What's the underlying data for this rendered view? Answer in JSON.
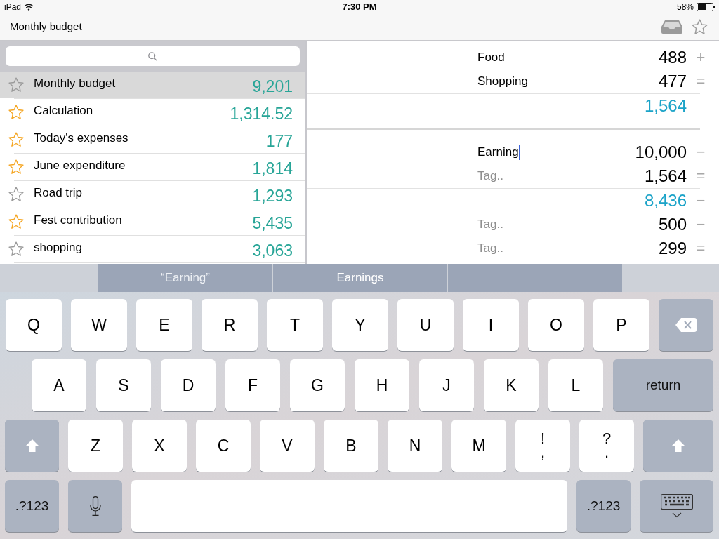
{
  "status_bar": {
    "device": "iPad",
    "time": "7:30 PM",
    "battery": "58%"
  },
  "nav_bar": {
    "title": "Monthly budget"
  },
  "sidebar": {
    "items": [
      {
        "title": "Monthly budget",
        "total": "9,201",
        "starred": false,
        "selected": true
      },
      {
        "title": "Calculation",
        "total": "1,314.52",
        "starred": true,
        "selected": false
      },
      {
        "title": "Today's expenses",
        "total": "177",
        "starred": true,
        "selected": false
      },
      {
        "title": "June expenditure",
        "total": "1,814",
        "starred": true,
        "selected": false
      },
      {
        "title": "Road trip",
        "total": "1,293",
        "starred": false,
        "selected": false
      },
      {
        "title": "Fest contribution",
        "total": "5,435",
        "starred": true,
        "selected": false
      },
      {
        "title": "shopping",
        "total": "3,063",
        "starred": false,
        "selected": false
      }
    ]
  },
  "sheet": {
    "sections": [
      {
        "rows": [
          {
            "kind": "entry",
            "tag": "Food",
            "amount": "488",
            "operator": "+",
            "focused": false
          },
          {
            "kind": "entry",
            "tag": "Shopping",
            "amount": "477",
            "operator": "=",
            "focused": false
          },
          {
            "kind": "total",
            "amount": "1,564"
          }
        ]
      },
      {
        "rows": [
          {
            "kind": "entry",
            "tag": "Earning",
            "amount": "10,000",
            "operator": "−",
            "focused": true
          },
          {
            "kind": "entry",
            "placeholder": "Tag..",
            "amount": "1,564",
            "operator": "=",
            "focused": false
          },
          {
            "kind": "total",
            "amount": "8,436",
            "operator": "−"
          },
          {
            "kind": "entry",
            "placeholder": "Tag..",
            "amount": "500",
            "operator": "−",
            "focused": false
          },
          {
            "kind": "entry",
            "placeholder": "Tag..",
            "amount": "299",
            "operator": "=",
            "focused": false
          }
        ]
      }
    ]
  },
  "keyboard": {
    "suggestions": [
      {
        "kind": "typed",
        "text": "“Earning”"
      },
      {
        "kind": "word",
        "text": "Earnings"
      }
    ],
    "rows": [
      [
        {
          "kind": "letter",
          "label": "Q"
        },
        {
          "kind": "letter",
          "label": "W"
        },
        {
          "kind": "letter",
          "label": "E"
        },
        {
          "kind": "letter",
          "label": "R"
        },
        {
          "kind": "letter",
          "label": "T"
        },
        {
          "kind": "letter",
          "label": "Y"
        },
        {
          "kind": "letter",
          "label": "U"
        },
        {
          "kind": "letter",
          "label": "I"
        },
        {
          "kind": "letter",
          "label": "O"
        },
        {
          "kind": "letter",
          "label": "P"
        },
        {
          "kind": "delete"
        }
      ],
      [
        {
          "kind": "letter",
          "label": "A"
        },
        {
          "kind": "letter",
          "label": "S"
        },
        {
          "kind": "letter",
          "label": "D"
        },
        {
          "kind": "letter",
          "label": "F"
        },
        {
          "kind": "letter",
          "label": "G"
        },
        {
          "kind": "letter",
          "label": "H"
        },
        {
          "kind": "letter",
          "label": "J"
        },
        {
          "kind": "letter",
          "label": "K"
        },
        {
          "kind": "letter",
          "label": "L"
        },
        {
          "kind": "return",
          "label": "return"
        }
      ],
      [
        {
          "kind": "shift"
        },
        {
          "kind": "letter",
          "label": "Z"
        },
        {
          "kind": "letter",
          "label": "X"
        },
        {
          "kind": "letter",
          "label": "C"
        },
        {
          "kind": "letter",
          "label": "V"
        },
        {
          "kind": "letter",
          "label": "B"
        },
        {
          "kind": "letter",
          "label": "N"
        },
        {
          "kind": "letter",
          "label": "M"
        },
        {
          "kind": "dual",
          "label": "!",
          "label_2": ","
        },
        {
          "kind": "dual",
          "label": "?",
          "label_2": "."
        },
        {
          "kind": "shift"
        }
      ],
      [
        {
          "kind": "numbers",
          "label": ".?123"
        },
        {
          "kind": "mic"
        },
        {
          "kind": "space"
        },
        {
          "kind": "numbers",
          "label": ".?123"
        },
        {
          "kind": "hide"
        }
      ]
    ]
  }
}
